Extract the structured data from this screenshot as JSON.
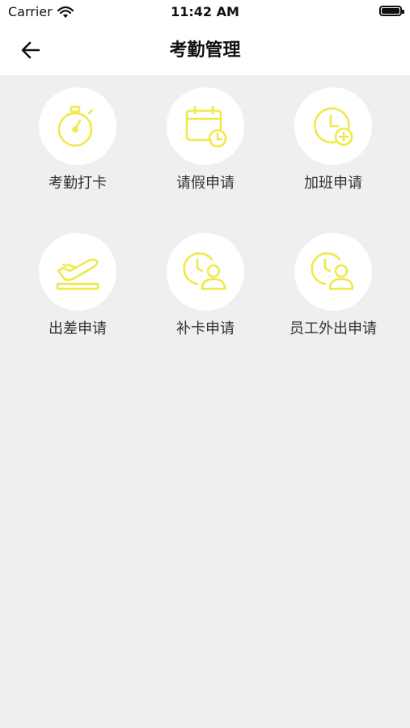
{
  "status": {
    "carrier": "Carrier",
    "time": "11:42 AM",
    "battery_level": 1.0
  },
  "nav": {
    "title": "考勤管理"
  },
  "accent_color": "#f1e84a",
  "items": [
    {
      "label": "考勤打卡",
      "icon": "stopwatch-icon"
    },
    {
      "label": "请假申请",
      "icon": "calendar-clock-icon"
    },
    {
      "label": "加班申请",
      "icon": "clock-plus-icon"
    },
    {
      "label": "出差申请",
      "icon": "plane-takeoff-icon"
    },
    {
      "label": "补卡申请",
      "icon": "clock-user-icon"
    },
    {
      "label": "员工外出申请",
      "icon": "clock-user-icon"
    }
  ]
}
